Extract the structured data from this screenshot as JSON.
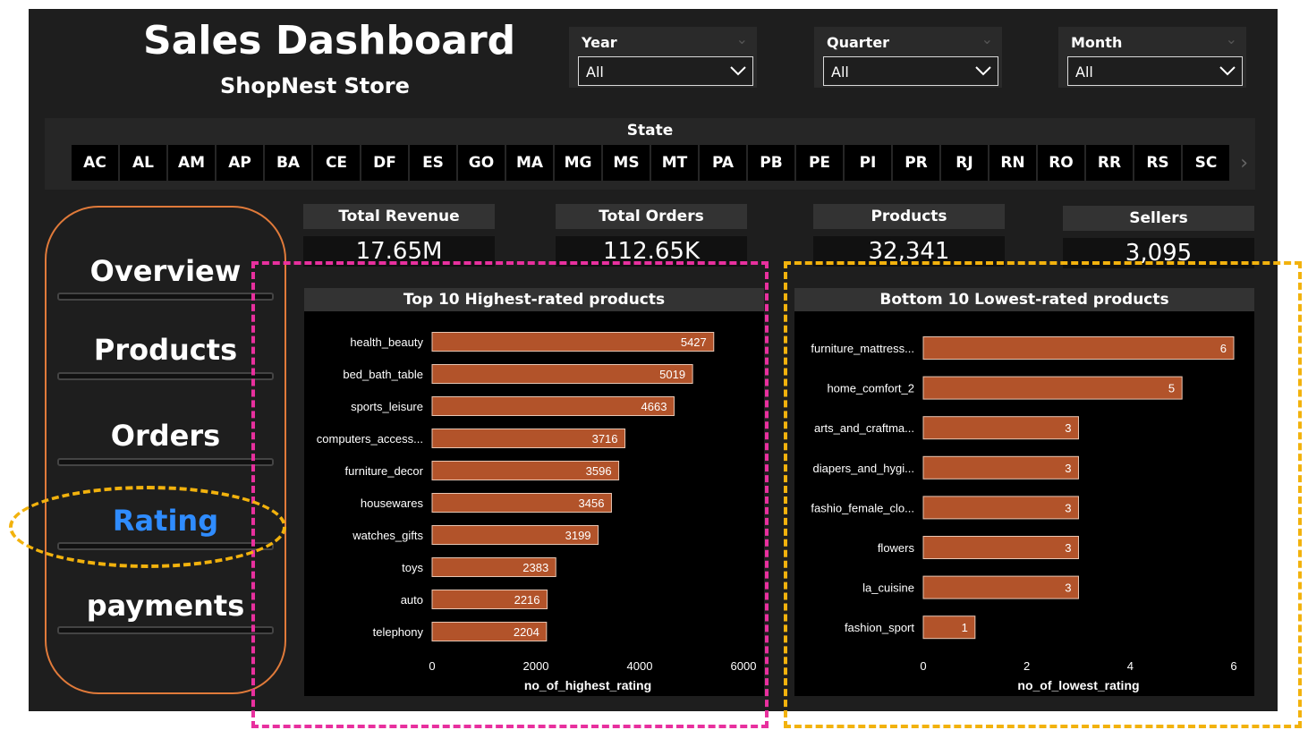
{
  "header": {
    "title": "Sales Dashboard",
    "subtitle": "ShopNest Store"
  },
  "filters": [
    {
      "label": "Year",
      "value": "All"
    },
    {
      "label": "Quarter",
      "value": "All"
    },
    {
      "label": "Month",
      "value": "All"
    }
  ],
  "states": {
    "label": "State",
    "items": [
      "AC",
      "AL",
      "AM",
      "AP",
      "BA",
      "CE",
      "DF",
      "ES",
      "GO",
      "MA",
      "MG",
      "MS",
      "MT",
      "PA",
      "PB",
      "PE",
      "PI",
      "PR",
      "RJ",
      "RN",
      "RO",
      "RR",
      "RS",
      "SC"
    ]
  },
  "nav": {
    "items": [
      "Overview",
      "Products",
      "Orders",
      "Rating",
      "payments"
    ],
    "active": "Rating"
  },
  "kpis": [
    {
      "label": "Total Revenue",
      "value": "17.65M"
    },
    {
      "label": "Total Orders",
      "value": "112.65K"
    },
    {
      "label": "Products",
      "value": "32,341"
    },
    {
      "label": "Sellers",
      "value": "3,095"
    }
  ],
  "colors": {
    "bar": "#b2532a",
    "active_nav": "#2f8cff",
    "panel_border": "#e07a3a",
    "highlight_pink": "#e8309e",
    "highlight_yellow": "#f2b20d"
  },
  "chart_data": [
    {
      "type": "bar",
      "title": "Top 10 Highest-rated products",
      "categories": [
        "health_beauty",
        "bed_bath_table",
        "sports_leisure",
        "computers_access...",
        "furniture_decor",
        "housewares",
        "watches_gifts",
        "toys",
        "auto",
        "telephony"
      ],
      "values": [
        5427,
        5019,
        4663,
        3716,
        3596,
        3456,
        3199,
        2383,
        2216,
        2204
      ],
      "xlabel": "no_of_highest_rating",
      "xlim": [
        0,
        6000
      ],
      "ticks": [
        0,
        2000,
        4000,
        6000
      ]
    },
    {
      "type": "bar",
      "title": "Bottom 10 Lowest-rated products",
      "categories": [
        "furniture_mattress...",
        "home_comfort_2",
        "arts_and_craftma...",
        "diapers_and_hygi...",
        "fashio_female_clo...",
        "flowers",
        "la_cuisine",
        "fashion_sport"
      ],
      "values": [
        6,
        5,
        3,
        3,
        3,
        3,
        3,
        1
      ],
      "xlabel": "no_of_lowest_rating",
      "xlim": [
        0,
        6
      ],
      "ticks": [
        0,
        2,
        4,
        6
      ]
    }
  ]
}
